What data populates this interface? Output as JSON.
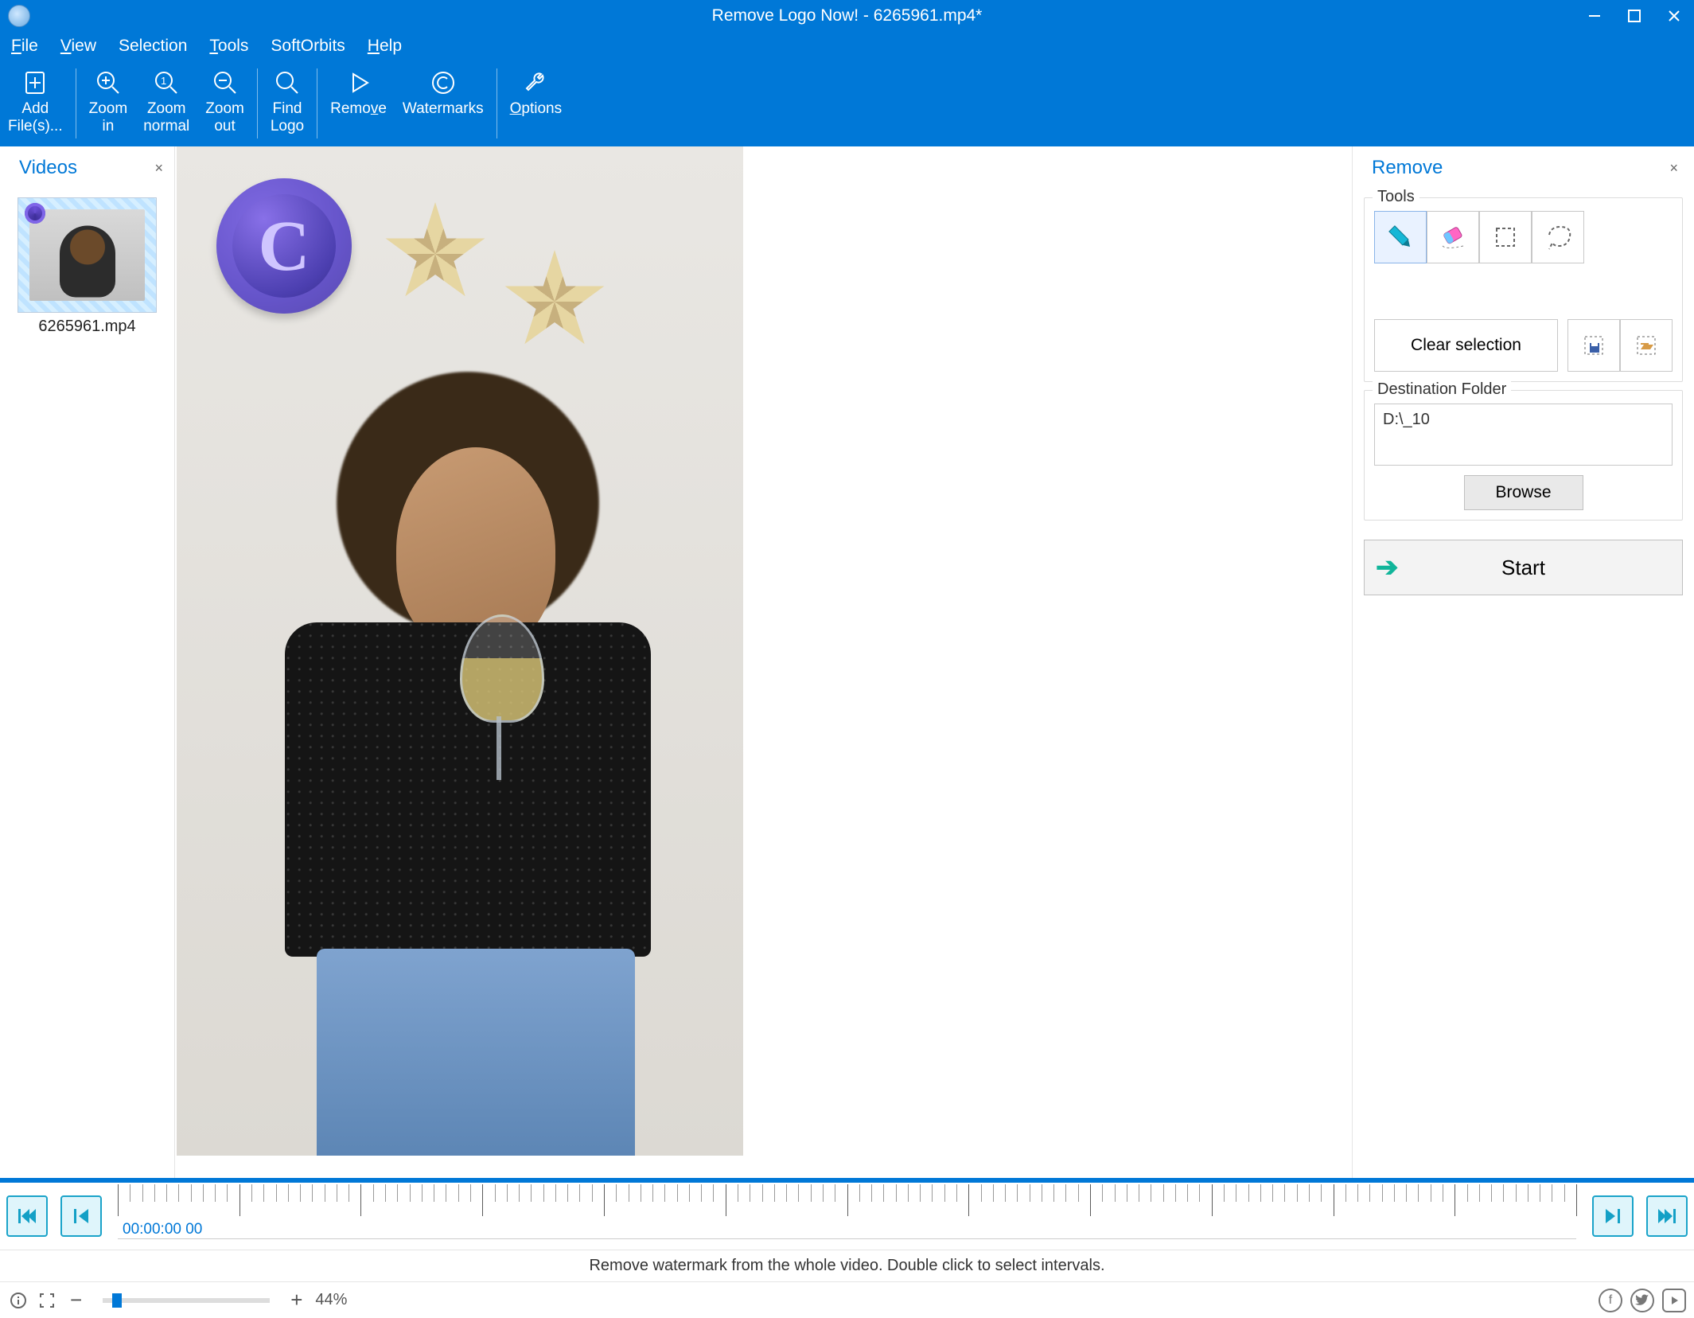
{
  "window": {
    "title": "Remove Logo Now! - 6265961.mp4*"
  },
  "menu": {
    "file": "File",
    "view": "View",
    "selection": "Selection",
    "tools": "Tools",
    "softorbits": "SoftOrbits",
    "help": "Help"
  },
  "toolbar": {
    "add_files": "Add\nFile(s)...",
    "zoom_in": "Zoom\nin",
    "zoom_normal": "Zoom\nnormal",
    "zoom_out": "Zoom\nout",
    "find_logo": "Find\nLogo",
    "remove": "Remove",
    "watermarks": "Watermarks",
    "options": "Options"
  },
  "videos_panel": {
    "title": "Videos",
    "item_label": "6265961.mp4"
  },
  "remove_panel": {
    "title": "Remove",
    "tools_legend": "Tools",
    "clear_selection": "Clear selection",
    "dest_legend": "Destination Folder",
    "dest_value": "D:\\_10",
    "browse": "Browse",
    "start": "Start"
  },
  "timeline": {
    "timecode": "00:00:00 00",
    "hint": "Remove watermark from the whole video. Double click to select intervals."
  },
  "statusbar": {
    "zoom_percent": "44%"
  }
}
